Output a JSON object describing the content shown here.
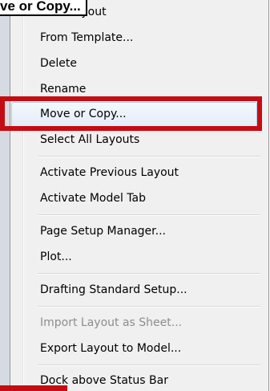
{
  "tooltip": "ve or Copy...",
  "menu": {
    "items": [
      {
        "label": "New Layout"
      },
      {
        "label": "From Template..."
      },
      {
        "label": "Delete"
      },
      {
        "label": "Rename"
      },
      {
        "label": "Move or Copy..."
      },
      {
        "label": "Select All Layouts"
      },
      {
        "label": "Activate Previous Layout"
      },
      {
        "label": "Activate Model Tab"
      },
      {
        "label": "Page Setup Manager..."
      },
      {
        "label": "Plot..."
      },
      {
        "label": "Drafting Standard Setup..."
      },
      {
        "label": "Import Layout as Sheet..."
      },
      {
        "label": "Export Layout to Model..."
      },
      {
        "label": "Dock above Status Bar"
      }
    ],
    "highlighted_item": "Move or Copy...",
    "disabled_item": "Import Layout as Sheet..."
  },
  "colors": {
    "highlight_border": "#c40d12",
    "hover_fill": "#e3ecf8",
    "menu_bg": "#f0f0f0",
    "disabled_text": "#8d8d8d"
  }
}
